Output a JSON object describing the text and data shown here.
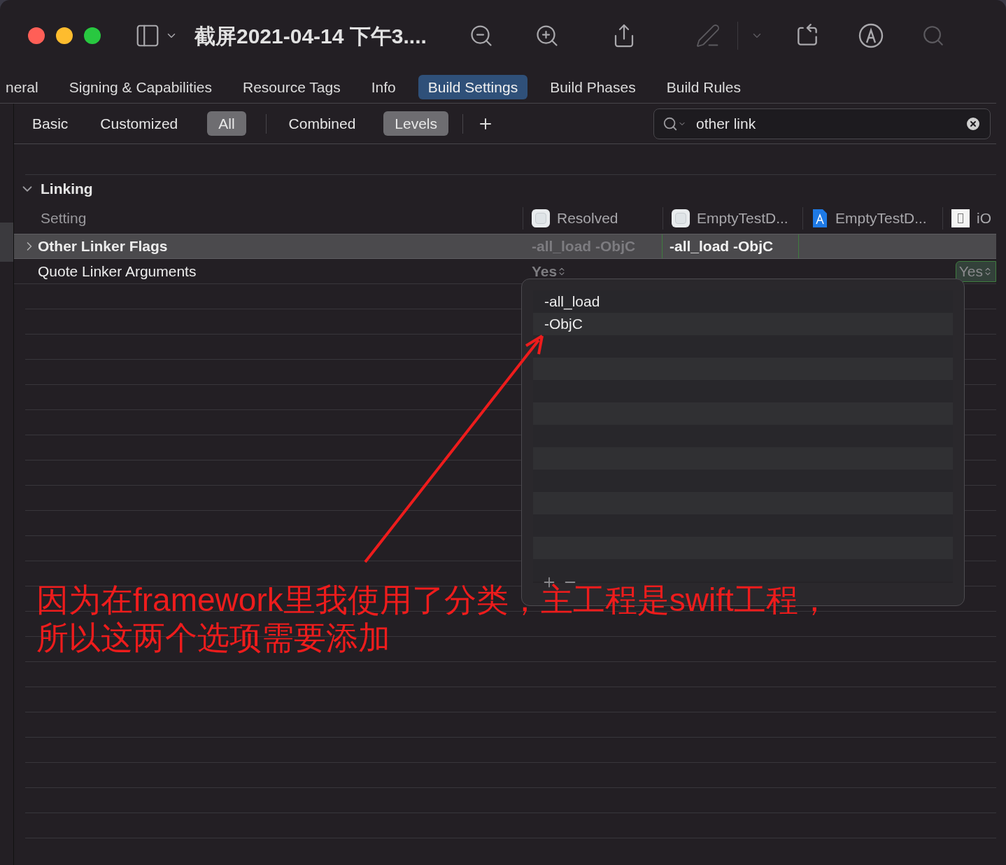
{
  "window": {
    "title": "截屏2021-04-14 下午3...."
  },
  "tabs": [
    {
      "label": "neral",
      "selected": false
    },
    {
      "label": "Signing & Capabilities",
      "selected": false
    },
    {
      "label": "Resource Tags",
      "selected": false
    },
    {
      "label": "Info",
      "selected": false
    },
    {
      "label": "Build Settings",
      "selected": true
    },
    {
      "label": "Build Phases",
      "selected": false
    },
    {
      "label": "Build Rules",
      "selected": false
    }
  ],
  "filters": [
    {
      "label": "Basic",
      "selected": false
    },
    {
      "label": "Customized",
      "selected": false
    },
    {
      "label": "All",
      "selected": true
    }
  ],
  "view_filters": [
    {
      "label": "Combined",
      "selected": false
    },
    {
      "label": "Levels",
      "selected": true
    }
  ],
  "search": {
    "value": "other link"
  },
  "section": {
    "title": "Linking",
    "expanded": true
  },
  "columns": [
    {
      "label": "Setting",
      "kind": "plain"
    },
    {
      "label": "Resolved",
      "kind": "resolved"
    },
    {
      "label": "EmptyTestD...",
      "kind": "resolved"
    },
    {
      "label": "EmptyTestD...",
      "kind": "app"
    },
    {
      "label": "iO",
      "kind": "device"
    }
  ],
  "rows": [
    {
      "name": "Other Linker Flags",
      "selected": true,
      "bold": true,
      "expandable": true,
      "values": [
        {
          "text": "-all_load -ObjC",
          "dim": true
        },
        {
          "text": "-all_load -ObjC",
          "dim": false
        }
      ]
    },
    {
      "name": "Quote Linker Arguments",
      "selected": false,
      "bold": false,
      "expandable": false,
      "values": [
        {
          "text": "Yes",
          "dim": true,
          "popup": true
        }
      ],
      "last": {
        "text": "Yes"
      }
    }
  ],
  "popup": {
    "items": [
      "-all_load",
      "-ObjC"
    ]
  },
  "annotation": {
    "lines": [
      "因为在framework里我使用了分类，主工程是swift工程，",
      "所以这两个选项需要添加"
    ]
  }
}
